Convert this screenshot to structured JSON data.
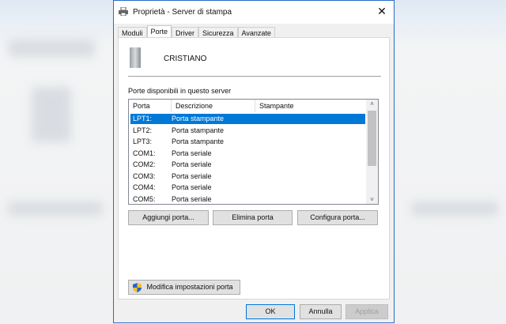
{
  "window": {
    "title": "Proprietà - Server di stampa",
    "close": "✕"
  },
  "tabs": [
    "Moduli",
    "Porte",
    "Driver",
    "Sicurezza",
    "Avanzate"
  ],
  "server_name": "CRISTIANO",
  "ports_label": "Porte disponibili in questo server",
  "columns": [
    "Porta",
    "Descrizione",
    "Stampante"
  ],
  "rows": [
    {
      "port": "LPT1:",
      "desc": "Porta stampante",
      "printer": ""
    },
    {
      "port": "LPT2:",
      "desc": "Porta stampante",
      "printer": ""
    },
    {
      "port": "LPT3:",
      "desc": "Porta stampante",
      "printer": ""
    },
    {
      "port": "COM1:",
      "desc": "Porta seriale",
      "printer": ""
    },
    {
      "port": "COM2:",
      "desc": "Porta seriale",
      "printer": ""
    },
    {
      "port": "COM3:",
      "desc": "Porta seriale",
      "printer": ""
    },
    {
      "port": "COM4:",
      "desc": "Porta seriale",
      "printer": ""
    },
    {
      "port": "COM5:",
      "desc": "Porta seriale",
      "printer": ""
    }
  ],
  "buttons": {
    "add": "Aggiungi porta...",
    "delete": "Elimina porta",
    "configure": "Configura porta...",
    "modify": "Modifica impostazioni porta",
    "ok": "OK",
    "cancel": "Annulla",
    "apply": "Applica"
  },
  "colors": {
    "accent": "#0078d7"
  }
}
